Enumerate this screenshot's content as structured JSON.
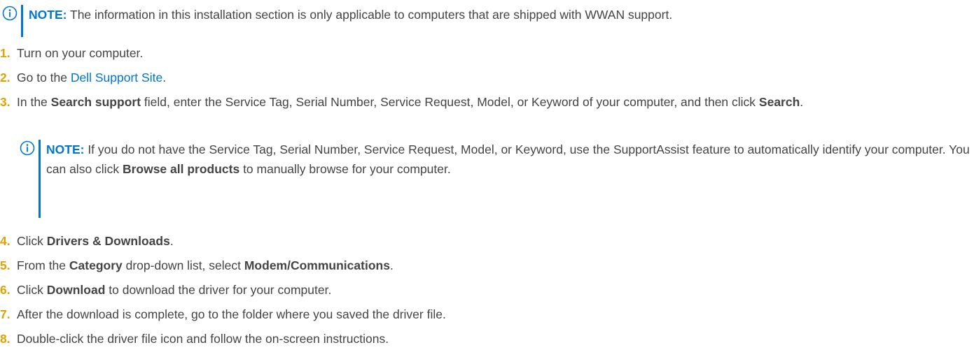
{
  "note_top": {
    "label": "NOTE:",
    "text": " The information in this installation section is only applicable to computers that are shipped with WWAN support."
  },
  "steps": [
    {
      "num": "1.",
      "text": "Turn on your computer."
    },
    {
      "num": "2.",
      "pre": "Go to the ",
      "link": "Dell Support Site",
      "post": "."
    },
    {
      "num": "3.",
      "pre": "In the ",
      "b1": "Search support",
      "mid": " field, enter the Service Tag, Serial Number, Service Request, Model, or Keyword of your computer, and then click ",
      "b2": "Search",
      "post": "."
    },
    {
      "num": "4.",
      "pre": "Click ",
      "b1": "Drivers & Downloads",
      "post": "."
    },
    {
      "num": "5.",
      "pre": "From the ",
      "b1": "Category",
      "mid": " drop-down list, select ",
      "b2": "Modem/Communications",
      "post": "."
    },
    {
      "num": "6.",
      "pre": "Click ",
      "b1": "Download",
      "post": " to download the driver for your computer."
    },
    {
      "num": "7.",
      "text": "After the download is complete, go to the folder where you saved the driver file."
    },
    {
      "num": "8.",
      "text": "Double-click the driver file icon and follow the on-screen instructions."
    }
  ],
  "note_step3": {
    "label": "NOTE:",
    "pre": " If you do not have the Service Tag, Serial Number, Service Request, Model, or Keyword, use the SupportAssist feature to automatically identify your computer. You can also click ",
    "b": "Browse all products",
    "post": " to manually browse for your computer."
  },
  "colors": {
    "accent": "#0076ce",
    "step_number": "#e1a100",
    "text": "#444444"
  },
  "icons": {
    "note": "info-circle-icon"
  }
}
